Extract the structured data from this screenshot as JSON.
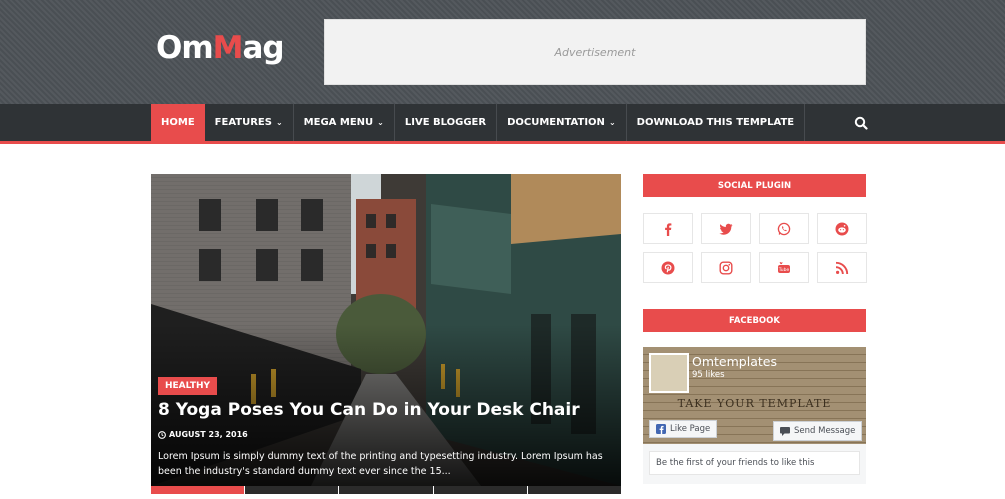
{
  "header": {
    "logo_part1": "Om",
    "logo_accent": "M",
    "logo_part2": "ag",
    "ad_label": "Advertisement"
  },
  "nav": {
    "items": [
      {
        "label": "HOME",
        "active": true
      },
      {
        "label": "FEATURES",
        "dropdown": true
      },
      {
        "label": "MEGA MENU",
        "dropdown": true
      },
      {
        "label": "LIVE BLOGGER"
      },
      {
        "label": "DOCUMENTATION",
        "dropdown": true
      },
      {
        "label": "DOWNLOAD THIS TEMPLATE"
      }
    ],
    "search_icon": "search-icon"
  },
  "featured": {
    "tag": "HEALTHY",
    "title": "8 Yoga Poses You Can Do in Your Desk Chair",
    "date": "AUGUST 23, 2016",
    "excerpt": "Lorem Ipsum is simply dummy text of the printing and typesetting industry. Lorem Ipsum has been the industry's standard dummy text ever since the 15..."
  },
  "sidebar": {
    "social_heading": "SOCIAL PLUGIN",
    "social_icons": [
      "facebook-icon",
      "twitter-icon",
      "whatsapp-icon",
      "reddit-icon",
      "pinterest-icon",
      "instagram-icon",
      "youtube-icon",
      "rss-icon"
    ],
    "facebook_heading": "FACEBOOK",
    "fb_page_name": "Omtemplates",
    "fb_likes": "95 likes",
    "fb_slogan": "TAKE YOUR TEMPLATE",
    "fb_like_button": "Like Page",
    "fb_message_button": "Send Message",
    "fb_friends_text": "Be the first of your friends to like this"
  },
  "colors": {
    "accent": "#e84c4c",
    "header_bg": "#4d5257",
    "nav_bg": "#2f3336"
  }
}
